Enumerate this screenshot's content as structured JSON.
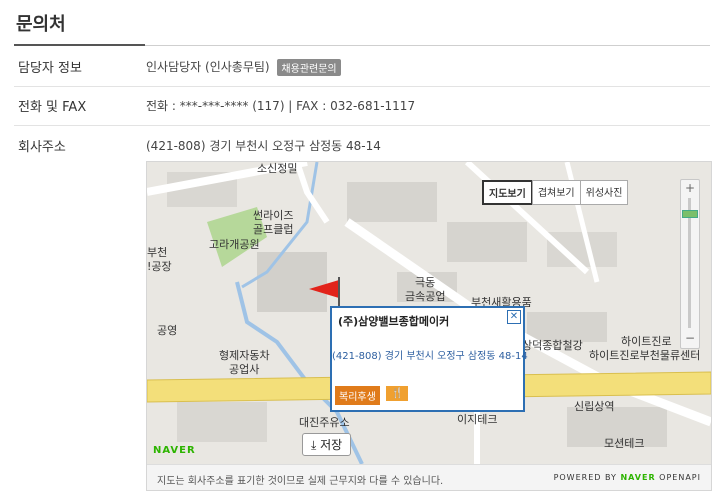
{
  "section_title": "문의처",
  "rows": {
    "contact": {
      "label": "담당자 정보",
      "value": "인사담당자 (인사총무팀)",
      "badge": "채용관련문의"
    },
    "phone": {
      "label": "전화 및 FAX",
      "value": "전화 : ***-***-**** (117) | FAX : 032-681-1117"
    },
    "address": {
      "label": "회사주소",
      "value": "(421-808) 경기 부천시 오정구 삼정동 48-14"
    }
  },
  "map": {
    "controls": [
      "지도보기",
      "겹쳐보기",
      "위성사진"
    ],
    "active_control": "지도보기",
    "zoom_plus": "+",
    "zoom_minus": "−",
    "labels": {
      "l1": "소신정밀",
      "l2": "썬라이즈",
      "l3": "골프클럽",
      "l4": "고라개공원",
      "l5": "부천",
      "l6": "!공장",
      "l7": "극동",
      "l8": "금속공업",
      "l9": "부천새활용품",
      "l10": "공영",
      "l11": "형제자동차",
      "l12": "공업사",
      "l13": "상덕종합철강",
      "l14": "하이트진로",
      "l15": "하이트진로부천물류센터",
      "l16": "신립상역",
      "l17": "이지테크",
      "l18": "대진주유소",
      "l19": "모션테크"
    },
    "popup": {
      "title": "(주)삼양밸브종합메이커",
      "close": "✕",
      "address": "(421-808) 경기 부천시 오정구 삼정동 48-14",
      "badge": "복리후생",
      "icon": "🍴"
    },
    "save_label": "⤓ 저장",
    "naver_logo": "NAVER",
    "footer_note": "지도는 회사주소를 표기한 것이므로 실제 근무지와 다를 수 있습니다.",
    "powered_prefix": "POWERED BY",
    "powered_naver": "NAVER",
    "powered_suffix": "OPENAPI",
    "colors": {
      "road_main": "#f3df7a",
      "park": "#b6d89a",
      "river": "#9fc3e6",
      "popup_border": "#2d6fb3"
    }
  }
}
